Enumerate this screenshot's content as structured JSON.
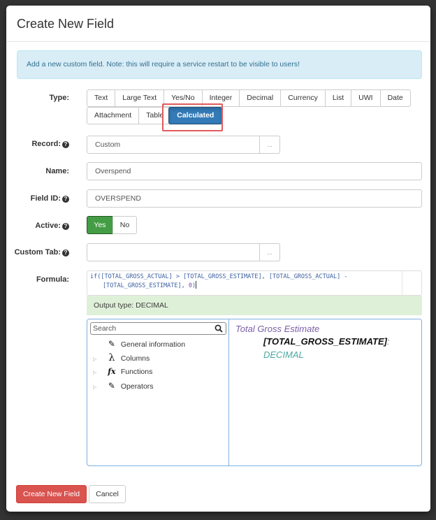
{
  "dialog": {
    "title": "Create New Field",
    "alert": "Add a new custom field. Note: this will require a service restart to be visible to users!"
  },
  "form": {
    "type": {
      "label": "Type:",
      "options": [
        "Text",
        "Large Text",
        "Yes/No",
        "Integer",
        "Decimal",
        "Currency",
        "List",
        "UWI",
        "Date",
        "Attachment",
        "Table",
        "Calculated"
      ],
      "selected": "Calculated"
    },
    "record": {
      "label": "Record:",
      "value": "Custom",
      "browse_label": "..."
    },
    "name": {
      "label": "Name:",
      "value": "Overspend"
    },
    "field_id": {
      "label": "Field ID:",
      "value": "OVERSPEND"
    },
    "active": {
      "label": "Active:",
      "yes_label": "Yes",
      "no_label": "No",
      "selected": "Yes"
    },
    "custom_tab": {
      "label": "Custom Tab:",
      "value": "",
      "browse_label": "..."
    },
    "formula": {
      "label": "Formula:",
      "line1": "if([TOTAL_GROSS_ACTUAL] > [TOTAL_GROSS_ESTIMATE], [TOTAL_GROSS_ACTUAL] -",
      "line2_prefix": "[TOTAL_GROSS_ESTIMATE], ",
      "line2_number": "0",
      "line2_suffix": ")",
      "output_type": "Output type: DECIMAL"
    }
  },
  "browser": {
    "search_placeholder": "Search",
    "tree": [
      {
        "label": "General information",
        "icon": "pencil-icon",
        "expandable": false
      },
      {
        "label": "Columns",
        "icon": "lambda-icon",
        "expandable": true
      },
      {
        "label": "Functions",
        "icon": "fx-icon",
        "expandable": true
      },
      {
        "label": "Operators",
        "icon": "pencil-icon",
        "expandable": true
      }
    ],
    "doc": {
      "title": "Total Gross Estimate",
      "id": "[TOTAL_GROSS_ESTIMATE]",
      "separator": ":",
      "type": "DECIMAL"
    }
  },
  "footer": {
    "create_label": "Create New Field",
    "cancel_label": "Cancel"
  },
  "colors": {
    "primary": "#337ab7",
    "success": "#449d44",
    "danger": "#d9534f",
    "info_bg": "#d9edf7",
    "success_bg": "#dff0d8",
    "highlight": "#e25a5a"
  }
}
